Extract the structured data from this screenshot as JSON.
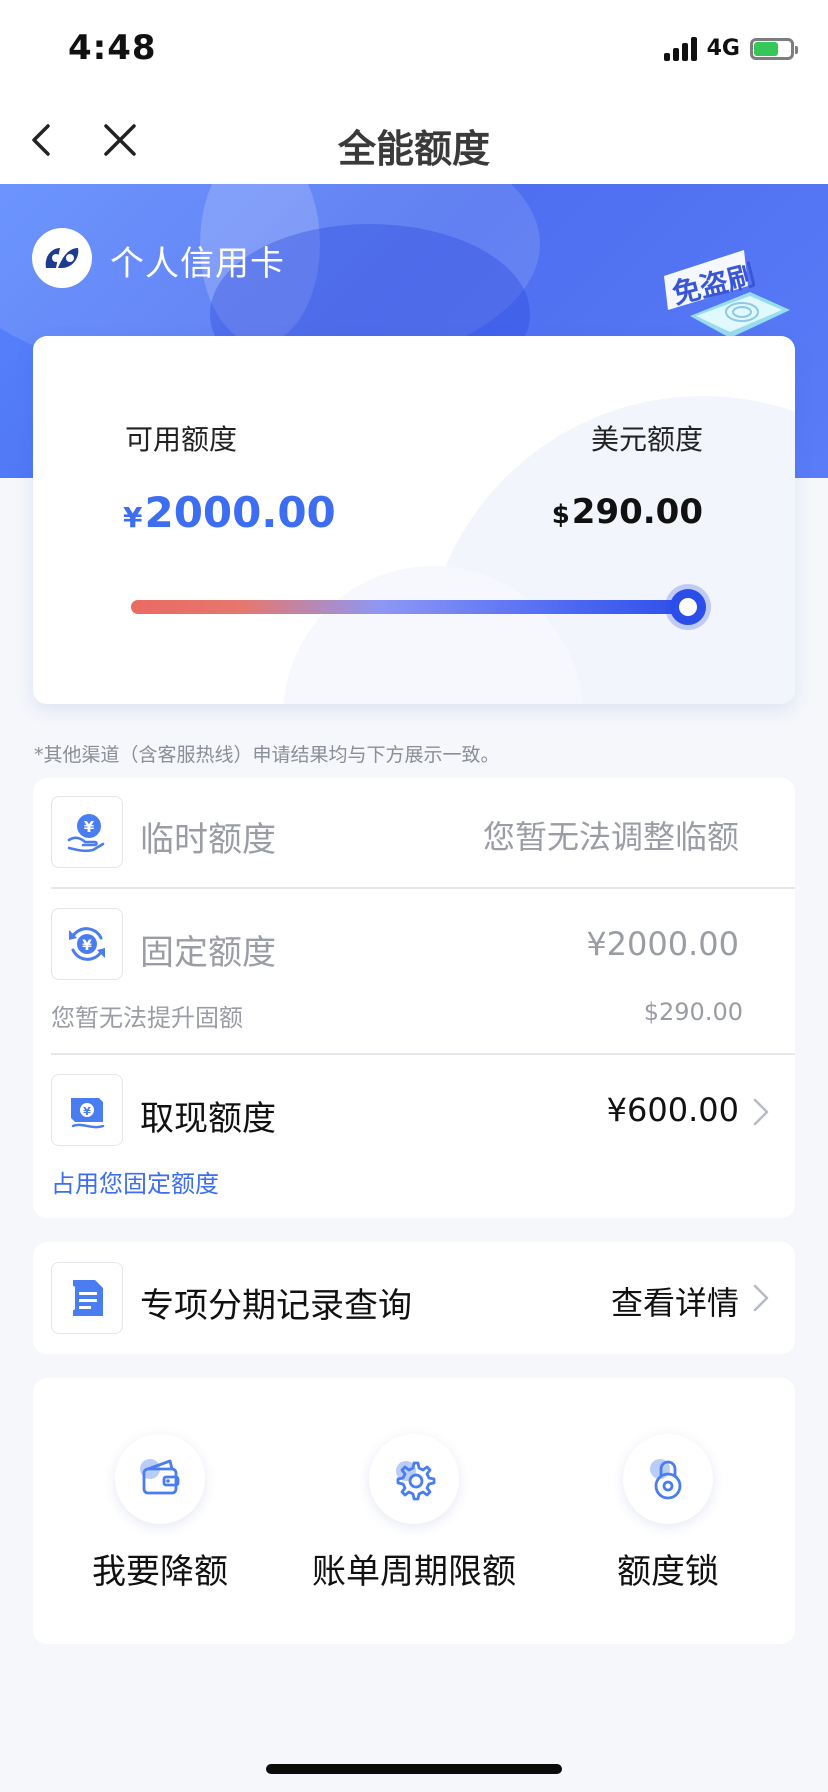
{
  "status_bar": {
    "time": "4:48",
    "network": "4G"
  },
  "nav": {
    "title": "全能额度"
  },
  "hero": {
    "card_type": "个人信用卡",
    "badge_text": "免盗刷"
  },
  "limit_card": {
    "available_label": "可用额度",
    "available_currency": "¥",
    "available_amount": "2000.00",
    "usd_label": "美元额度",
    "usd_currency": "$",
    "usd_amount": "290.00",
    "slider_fraction": 1.0
  },
  "notice": "*其他渠道（含客服热线）申请结果均与下方展示一致。",
  "limits": {
    "temporary": {
      "title": "临时额度",
      "value": "您暂无法调整临额",
      "icon": "yen-hand-icon"
    },
    "fixed": {
      "title": "固定额度",
      "value": "¥2000.00",
      "sub_left": "您暂无法提升固额",
      "sub_right": "$290.00",
      "icon": "yen-refresh-icon"
    },
    "cash": {
      "title": "取现额度",
      "value": "¥600.00",
      "sub_left": "占用您固定额度",
      "icon": "cash-note-icon"
    }
  },
  "installment": {
    "title": "专项分期记录查询",
    "action": "查看详情",
    "icon": "document-icon"
  },
  "actions": [
    {
      "label": "我要降额",
      "icon": "wallet-icon"
    },
    {
      "label": "账单周期限额",
      "icon": "gear-icon"
    },
    {
      "label": "额度锁",
      "icon": "lock-icon"
    }
  ],
  "colors": {
    "accent": "#3d6ef2",
    "hero_start": "#5886ff",
    "hero_end": "#4d6ff0",
    "muted_text": "#9a9da3",
    "link_blue": "#3d6ef2"
  }
}
